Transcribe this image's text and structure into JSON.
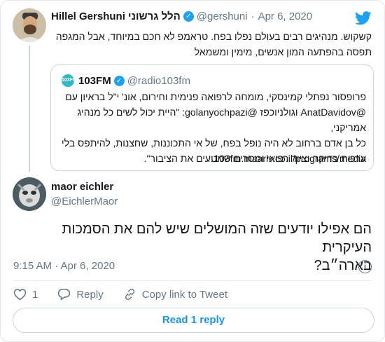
{
  "colors": {
    "link": "#1b95e0",
    "verified": "#1da1f2",
    "muted": "#657786",
    "border": "#ccd6dd"
  },
  "parent_tweet": {
    "name": "Hillel Gershuni הלל גרשוני",
    "handle": "@gershuni",
    "separator": "·",
    "date": "Apr 6, 2020",
    "text_line1": "קשקוש. מנהיגים רבים בעולם נפלו בפח. טראמפ לא חכם במיוחד, אבל המגפה",
    "text_line2": "תפסה בהפתעה המון אנשים, מימין ומשמאל",
    "quoted": {
      "name": "103FM",
      "handle": "@radio103fm",
      "logo_text": "103FM",
      "line1": "פרופסור נפתלי קמינסקי, מומחה לרפואה פנימית וחירום, אונ' י\"ל בראיון עם",
      "line2": "@AnatDavidov וגולניוכפז @golanyochpazi: \"היית יכול לשים כל מנהיג אמריקני,",
      "line3": "כל בן אדם ברחוב לא היה נופל בפח, של אי התכוננות, שחצנות, להיתפס בלי",
      "line4": "ערכות בדיקה וציוד רפואי ומסרים שמטעים את הציבור\".",
      "link": "103fm.maariv.co.il/programs/media…"
    }
  },
  "main_tweet": {
    "name": "maor eichler",
    "handle": "@EichlerMaor",
    "text_line1": "הם אפילו יודעים שזה המושלים שיש להם את הסמכות העיקרית",
    "text_line2": "בארה״ב?",
    "timestamp": "9:15 AM · Apr 6, 2020",
    "likes_count": "1",
    "reply_label": "Reply",
    "copy_link_label": "Copy link to Tweet",
    "read_replies_label": "Read 1 reply"
  }
}
